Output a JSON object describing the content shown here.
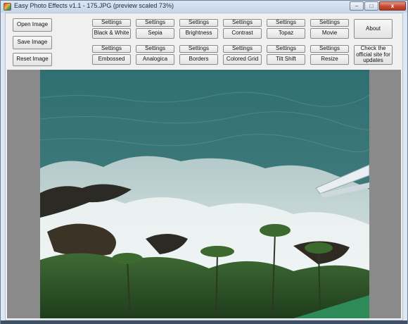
{
  "window": {
    "title": "Easy Photo Effects v1.1 - 175.JPG (preview scaled 73%)",
    "controls": {
      "minimize": "–",
      "maximize": "□",
      "close": "x"
    }
  },
  "file_buttons": {
    "open": "Open Image",
    "save": "Save Image",
    "reset": "Reset Image"
  },
  "effects_row1": [
    {
      "settings": "Settings",
      "effect": "Black & White"
    },
    {
      "settings": "Settings",
      "effect": "Sepia"
    },
    {
      "settings": "Settings",
      "effect": "Brightness"
    },
    {
      "settings": "Settings",
      "effect": "Contrast"
    },
    {
      "settings": "Settings",
      "effect": "Topaz"
    },
    {
      "settings": "Settings",
      "effect": "Movie"
    }
  ],
  "effects_row2": [
    {
      "settings": "Settings",
      "effect": "Embossed"
    },
    {
      "settings": "Settings",
      "effect": "Analogica"
    },
    {
      "settings": "Settings",
      "effect": "Borders"
    },
    {
      "settings": "Settings",
      "effect": "Colored Grid"
    },
    {
      "settings": "Settings",
      "effect": "Tilt Shift"
    },
    {
      "settings": "Settings",
      "effect": "Resize"
    }
  ],
  "about_button": "About",
  "updates_button": "Check the official site for updates",
  "preview": {
    "subject": "coastline photo preview",
    "colors": {
      "sea": "#3f7a7a",
      "foam": "#e8eef0",
      "rocks": "#2c2a24",
      "foliage": "#2f5a2c"
    }
  }
}
